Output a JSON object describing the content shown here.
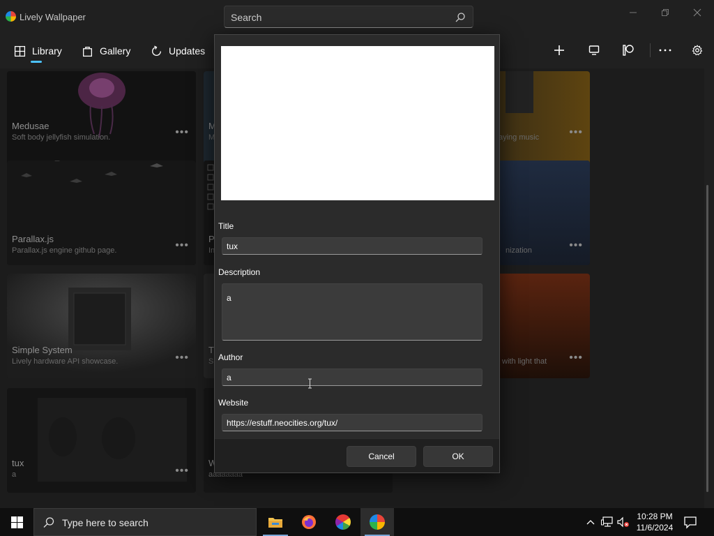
{
  "window": {
    "title": "Lively Wallpaper",
    "search_placeholder": "Search"
  },
  "nav": {
    "items": [
      {
        "label": "Library",
        "icon": "grid-icon"
      },
      {
        "label": "Gallery",
        "icon": "bag-icon"
      },
      {
        "label": "Updates",
        "icon": "refresh-icon"
      }
    ],
    "active": "Library",
    "accent": "#4cc2ff"
  },
  "library": {
    "cards": [
      {
        "name": "Medusae",
        "description": "Soft body jellyfish simulation."
      },
      {
        "name": "M",
        "description": "M"
      },
      {
        "name": "",
        "description": "aying music"
      },
      {
        "name": "Parallax.js",
        "description": "Parallax.js engine github page."
      },
      {
        "name": "P",
        "description": "In"
      },
      {
        "name": "",
        "description": "nization"
      },
      {
        "name": "Simple System",
        "description": "Lively hardware API showcase."
      },
      {
        "name": "T",
        "description": "S"
      },
      {
        "name": "",
        "description": "with light that"
      },
      {
        "name": "tux",
        "description": "a"
      },
      {
        "name": "W",
        "description": "aaaaaaaa"
      }
    ]
  },
  "dialog": {
    "fields": {
      "title": {
        "label": "Title",
        "value": "tux"
      },
      "description": {
        "label": "Description",
        "value": "a"
      },
      "author": {
        "label": "Author",
        "value": "a"
      },
      "website": {
        "label": "Website",
        "value": "https://estuff.neocities.org/tux/"
      }
    },
    "cancel_label": "Cancel",
    "ok_label": "OK"
  },
  "taskbar": {
    "search_placeholder": "Type here to search",
    "apps": [
      "file-explorer-icon",
      "firefox-icon",
      "color-wheel-icon",
      "lively-icon"
    ],
    "time": "10:28 PM",
    "date": "11/6/2024"
  }
}
